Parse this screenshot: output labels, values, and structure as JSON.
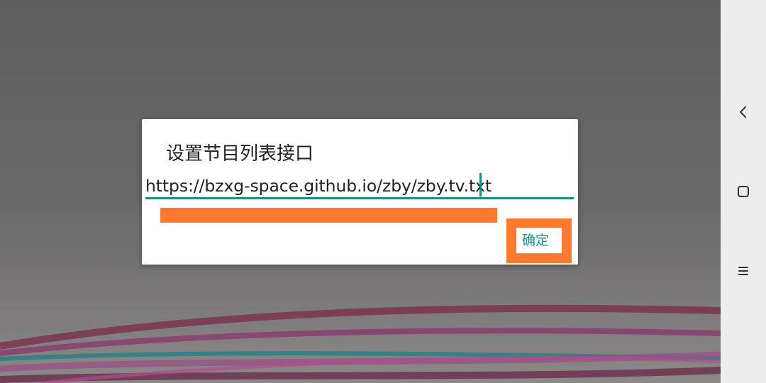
{
  "dialog": {
    "title": "设置节目列表接口",
    "url_value": "https://bzxg-space.github.io/zby/zby.tv.txt",
    "ok_label": "确定"
  },
  "navbar": {
    "icons": [
      "back-icon",
      "home-icon",
      "menu-icon"
    ]
  },
  "colors": {
    "accent": "#1a8f87",
    "highlight": "#ff7a2e",
    "dialog_bg": "#ffffff",
    "backdrop": "#666666",
    "navbar_bg": "#ededed"
  }
}
